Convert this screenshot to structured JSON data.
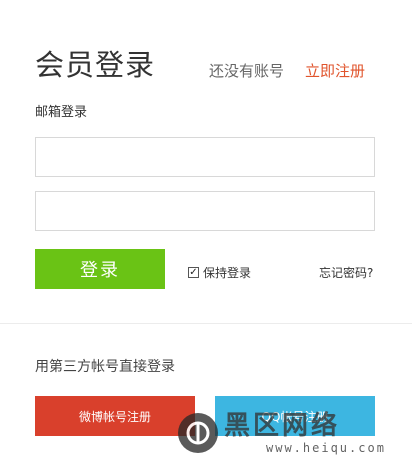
{
  "header": {
    "title": "会员登录",
    "no_account_text": "还没有账号",
    "register_link": "立即注册"
  },
  "form": {
    "email_login_label": "邮箱登录",
    "username_value": "",
    "password_value": "",
    "login_button": "登录",
    "remember_label": "保持登录",
    "remember_checked": true,
    "forgot_link": "忘记密码?"
  },
  "third_party": {
    "label": "用第三方帐号直接登录",
    "weibo_button": "微博帐号注册",
    "qq_button": "QQ帐号注册"
  },
  "watermark": {
    "text": "黑区网络",
    "url": "www.heiqu.com"
  },
  "colors": {
    "accent_orange": "#e0542c",
    "login_green": "#6ac315",
    "weibo_red": "#d9402c",
    "qq_blue": "#3db6e1"
  }
}
